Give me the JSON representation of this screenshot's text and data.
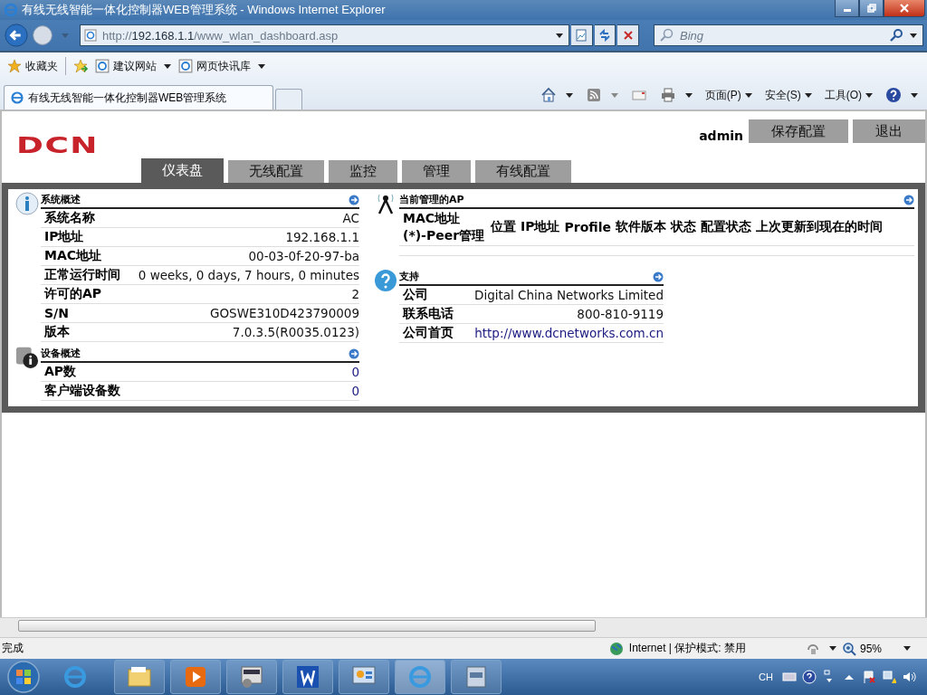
{
  "window": {
    "title": "有线无线智能一体化控制器WEB管理系统 - Windows Internet Explorer"
  },
  "address": {
    "prefix": "http://",
    "host": "192.168.1.1",
    "path": "/www_wlan_dashboard.asp"
  },
  "search": {
    "placeholder": "Bing"
  },
  "favorites": {
    "label": "收藏夹",
    "links": [
      {
        "label": "建议网站"
      },
      {
        "label": "网页快讯库"
      }
    ]
  },
  "browser_tab": {
    "title": "有线无线智能一体化控制器WEB管理系统"
  },
  "command_bar": [
    "页面(P)",
    "安全(S)",
    "工具(O)"
  ],
  "page": {
    "logo": "DCN",
    "user": "admin",
    "buttons": [
      "保存配置",
      "退出"
    ],
    "nav": [
      {
        "label": "仪表盘",
        "selected": true
      },
      {
        "label": "无线配置",
        "selected": false
      },
      {
        "label": "监控",
        "selected": false
      },
      {
        "label": "管理",
        "selected": false
      },
      {
        "label": "有线配置",
        "selected": false
      }
    ]
  },
  "system_overview": {
    "title": "系统概述",
    "rows": [
      {
        "label": "系统名称",
        "value": "AC"
      },
      {
        "label": "IP地址",
        "value": "192.168.1.1"
      },
      {
        "label": "MAC地址",
        "value": "00-03-0f-20-97-ba"
      },
      {
        "label": "正常运行时间",
        "value": "0 weeks, 0 days, 7 hours, 0 minutes"
      },
      {
        "label": "许可的AP",
        "value": "2"
      },
      {
        "label": "S/N",
        "value": "GOSWE310D423790009"
      },
      {
        "label": "版本",
        "value": "7.0.3.5(R0035.0123)"
      }
    ]
  },
  "device_overview": {
    "title": "设备概述",
    "rows": [
      {
        "label": "AP数",
        "value": "0",
        "kind": "link"
      },
      {
        "label": "客户端设备数",
        "value": "0",
        "kind": "link"
      }
    ]
  },
  "managed_aps": {
    "title": "当前管理的AP",
    "columns": [
      "MAC地址 (*)-Peer管理",
      "位置",
      "IP地址",
      "Profile",
      "软件版本",
      "状态",
      "配置状态",
      "上次更新到现在的时间"
    ]
  },
  "support": {
    "title": "支持",
    "rows": [
      {
        "label": "公司",
        "value": "Digital China Networks Limited",
        "kind": "text"
      },
      {
        "label": "联系电话",
        "value": "800-810-9119",
        "kind": "text"
      },
      {
        "label": "公司首页",
        "value": "http://www.dcnetworks.com.cn",
        "kind": "link"
      }
    ]
  },
  "status_bar": {
    "text": "完成",
    "zone": "Internet | 保护模式: 禁用",
    "zoom": "95%"
  },
  "taskbar": {
    "language": "CH"
  }
}
